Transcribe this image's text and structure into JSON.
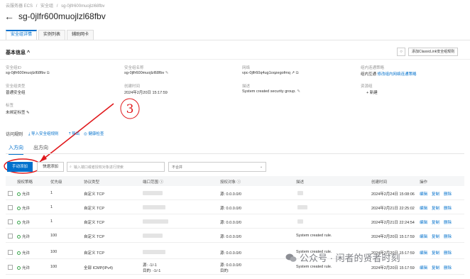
{
  "breadcrumb": [
    "云服务器 ECS",
    "/",
    "安全组",
    "/",
    "sg-0jlfr600muojlzl68fbv"
  ],
  "title": "sg-0jlfr600muojlzl68fbv",
  "tabs": [
    "安全组详情",
    "实例列表",
    "辅助网卡"
  ],
  "section": {
    "title": "基本信息",
    "add_button": "添加ClassicLink安全组规则"
  },
  "info": {
    "id_label": "安全组ID",
    "id_value": "sg-0jlfr600muojlzl68fbv",
    "name_label": "安全组名称",
    "name_value": "sg-0jlfr600muojlzl68fbv",
    "vpc_label": "网络",
    "vpc_value": "vpc-0jlfr60q4ug1oqzegofmq",
    "classic_label": "组内连通策略",
    "classic_value": "组内互通",
    "classic_link": "修改组内网络连通策略",
    "type_label": "安全组类型",
    "type_value": "普通安全组",
    "created_label": "创建时间",
    "created_value": "2024年2月20日 15:17:59",
    "desc_label": "描述",
    "desc_value": "System created security group.",
    "tag_label": "资源组",
    "tag_link": "+ 新建",
    "rg_label": "标签",
    "rg_value": "未绑定标签"
  },
  "annotation": "3",
  "rules": {
    "title": "访问规则",
    "import": "导入安全组规则",
    "export": "导出",
    "health": "健康检查"
  },
  "direction_tabs": [
    "入方向",
    "出方向"
  ],
  "toolbar": {
    "manual_add": "手动添加",
    "quick_add": "快速添加",
    "search_placeholder": "输入端口或者授权对象进行搜索",
    "select_value": "不合并"
  },
  "columns": [
    "授权策略",
    "优先级",
    "协议类型",
    "端口范围",
    "授权对象",
    "描述",
    "创建时间",
    "操作"
  ],
  "rows": [
    {
      "policy": "允许",
      "priority": "1",
      "protocol": "自定义 TCP",
      "object": "源: 0.0.0.0/0",
      "desc": "",
      "time": "2024年2月24日 15:08:06"
    },
    {
      "policy": "允许",
      "priority": "1",
      "protocol": "自定义 TCP",
      "object": "源: 0.0.0.0/0",
      "desc": "",
      "time": "2024年2月21日 22:25:02"
    },
    {
      "policy": "允许",
      "priority": "1",
      "protocol": "自定义 TCP",
      "object": "源: 0.0.0.0/0",
      "desc": "",
      "time": "2024年2月21日 22:24:54"
    },
    {
      "policy": "允许",
      "priority": "100",
      "protocol": "自定义 TCP",
      "object": "源: 0.0.0.0/0",
      "desc": "System created rule.",
      "time": "2024年2月20日 15:17:59"
    },
    {
      "policy": "允许",
      "priority": "100",
      "protocol": "自定义 TCP",
      "object": "源: 0.0.0.0/0",
      "desc": "System created rule.",
      "time": "2024年2月20日 15:17:59"
    },
    {
      "policy": "允许",
      "priority": "100",
      "protocol": "全部 ICMP(IPv4)",
      "port": "源: -1/-1",
      "port2": "目的: -1/-1",
      "object": "源: 0.0.0.0/0",
      "object2": "目的:",
      "desc": "System created rule.",
      "time": "2024年2月20日 15:17:59"
    }
  ],
  "ops": [
    "编辑",
    "复制",
    "删除"
  ],
  "watermark": "公众号 · 闲者的贤者时刻",
  "colors": {
    "accent": "#0070cc",
    "annotation": "#e0181b",
    "ok": "#3aa64c"
  }
}
